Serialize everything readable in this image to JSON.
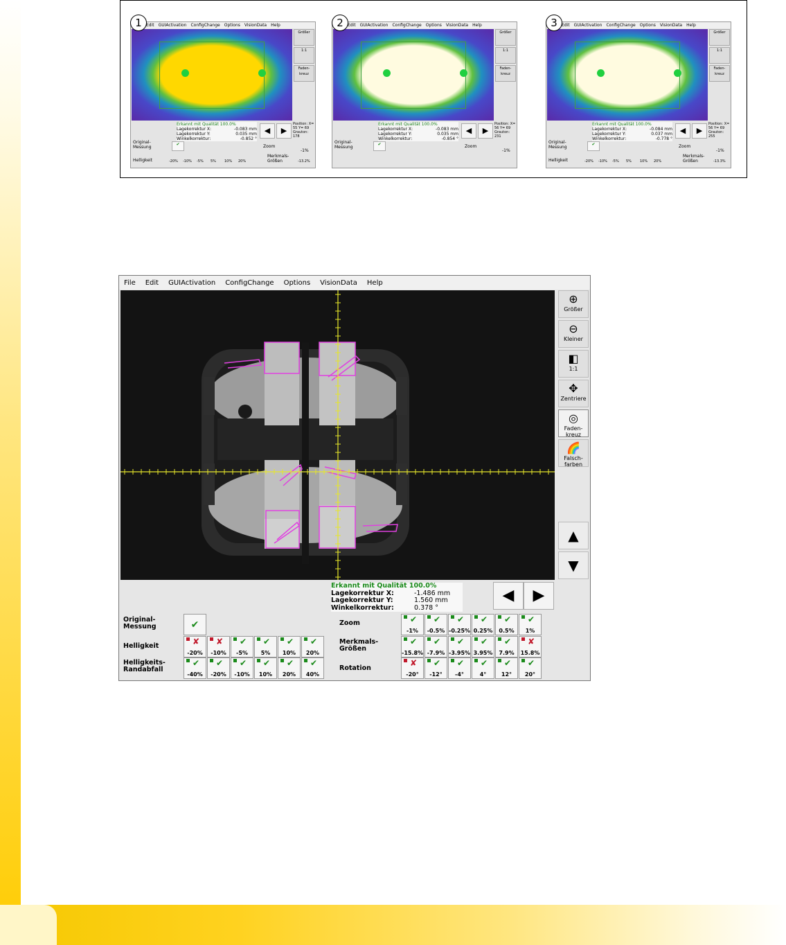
{
  "menu": [
    "File",
    "Edit",
    "GUIActivation",
    "ConfigChange",
    "Options",
    "VisionData",
    "Help"
  ],
  "mini": [
    {
      "number": "1",
      "menu": [
        "Edit",
        "GUIActivation",
        "ConfigChange",
        "Options",
        "VisionData",
        "Help"
      ],
      "colors": {
        "fill": "#ffd800",
        "border": "#40a040",
        "bg": "#4848c8"
      },
      "buttons": [
        "Größer",
        "1:1",
        "Faden-kreuz"
      ],
      "info": {
        "title": "Erkannt mit Qualität 100.0%",
        "x_label": "Lagekorrektur X:",
        "x": "-0.083 mm",
        "y_label": "Lagekorrektur Y:",
        "y": "0.035 mm",
        "w_label": "Winkelkorrektur:",
        "w": "-0.852 °"
      },
      "position": "Position: X= 55 Y= 69 Grauton: 178",
      "orig": "Original-Messung",
      "zoom": "Zoom",
      "zoom_val": "-1%",
      "helligkeit": "Helligkeit",
      "merkmals": "Merkmals-Größen",
      "merkmals_val": "-13.2%",
      "levels": [
        "-20%",
        "-10%",
        "-5%",
        "5%",
        "10%",
        "20%"
      ]
    },
    {
      "number": "2",
      "menu": [
        "Edit",
        "GUIActivation",
        "ConfigChange",
        "Options",
        "VisionData",
        "Help"
      ],
      "colors": {
        "fill": "#fffbe0",
        "border": "#40a040",
        "bg": "#4848c8"
      },
      "buttons": [
        "Größer",
        "1:1",
        "Faden-kreuz"
      ],
      "info": {
        "title": "Erkannt mit Qualität 100.0%",
        "x_label": "Lagekorrektur X:",
        "x": "-0.083 mm",
        "y_label": "Lagekorrektur Y:",
        "y": "0.035 mm",
        "w_label": "Winkelkorrektur:",
        "w": "-0.854 °"
      },
      "position": "Position: X= 56 Y= 69 Grauton: 231",
      "orig": "Original-Messung",
      "zoom": "Zoom",
      "zoom_val": "-1%"
    },
    {
      "number": "3",
      "menu": [
        "Edit",
        "GUIActivation",
        "ConfigChange",
        "Options",
        "VisionData",
        "Help"
      ],
      "colors": {
        "fill": "#fffbe0",
        "border": "#40a040",
        "bg": "#4848c8"
      },
      "buttons": [
        "Größer",
        "1:1",
        "Faden-kreuz"
      ],
      "info": {
        "title": "Erkannt mit Qualität 100.0%",
        "x_label": "Lagekorrektur X:",
        "x": "-0.084 mm",
        "y_label": "Lagekorrektur Y:",
        "y": "0.037 mm",
        "w_label": "Winkelkorrektur:",
        "w": "-0.778 °"
      },
      "position": "Position: X= 56 Y= 69 Grauton: 255",
      "orig": "Original-Messung",
      "zoom": "Zoom",
      "zoom_val": "-1%",
      "helligkeit": "Helligkeit",
      "merkmals": "Merkmals-Größen",
      "merkmals_val": "-13.3%",
      "levels": [
        "-20%",
        "-10%",
        "-5%",
        "5%",
        "10%",
        "20%"
      ]
    }
  ],
  "side_buttons": [
    {
      "label": "Größer",
      "icon": "zoom-in-icon",
      "glyph": "⊕"
    },
    {
      "label": "Kleiner",
      "icon": "zoom-out-icon",
      "glyph": "⊖"
    },
    {
      "label": "1:1",
      "icon": "one-to-one-icon",
      "glyph": "◧"
    },
    {
      "label": "Zentriere",
      "icon": "center-icon",
      "glyph": "✥"
    },
    {
      "label": "Faden-kreuz",
      "icon": "crosshair-icon",
      "glyph": "◎"
    },
    {
      "label": "Falsch-farben",
      "icon": "rainbow-icon",
      "glyph": "🌈"
    }
  ],
  "info": {
    "title": "Erkannt mit Qualität  100.0%",
    "x_label": "Lagekorrektur X:",
    "x": "-1.486 mm",
    "y_label": "Lagekorrektur Y:",
    "y": "1.560 mm",
    "w_label": "Winkelkorrektur:",
    "w": "0.378 °"
  },
  "panel": {
    "original_label": "Original-Messung",
    "helligkeit_label": "Helligkeit",
    "randabfall_label": "Helligkeits-Randabfall",
    "zoom_label": "Zoom",
    "merkmals_label": "Merkmals-Größen",
    "rotation_label": "Rotation",
    "helligkeit": [
      {
        "v": "-20%",
        "ok": false
      },
      {
        "v": "-10%",
        "ok": false
      },
      {
        "v": "-5%",
        "ok": true
      },
      {
        "v": "5%",
        "ok": true
      },
      {
        "v": "10%",
        "ok": true
      },
      {
        "v": "20%",
        "ok": true
      }
    ],
    "randabfall": [
      {
        "v": "-40%",
        "ok": true
      },
      {
        "v": "-20%",
        "ok": true
      },
      {
        "v": "-10%",
        "ok": true
      },
      {
        "v": "10%",
        "ok": true
      },
      {
        "v": "20%",
        "ok": true
      },
      {
        "v": "40%",
        "ok": true
      }
    ],
    "zoom": [
      {
        "v": "-1%",
        "ok": true
      },
      {
        "v": "-0.5%",
        "ok": true
      },
      {
        "v": "-0.25%",
        "ok": true
      },
      {
        "v": "0.25%",
        "ok": true
      },
      {
        "v": "0.5%",
        "ok": true
      },
      {
        "v": "1%",
        "ok": true
      }
    ],
    "merkmals": [
      {
        "v": "-15.8%",
        "ok": true
      },
      {
        "v": "-7.9%",
        "ok": true
      },
      {
        "v": "-3.95%",
        "ok": true
      },
      {
        "v": "3.95%",
        "ok": true
      },
      {
        "v": "7.9%",
        "ok": true
      },
      {
        "v": "15.8%",
        "ok": false
      }
    ],
    "rotation": [
      {
        "v": "-20°",
        "ok": false
      },
      {
        "v": "-12°",
        "ok": true
      },
      {
        "v": "-4°",
        "ok": true
      },
      {
        "v": "4°",
        "ok": true
      },
      {
        "v": "12°",
        "ok": true
      },
      {
        "v": "20°",
        "ok": true
      }
    ]
  }
}
